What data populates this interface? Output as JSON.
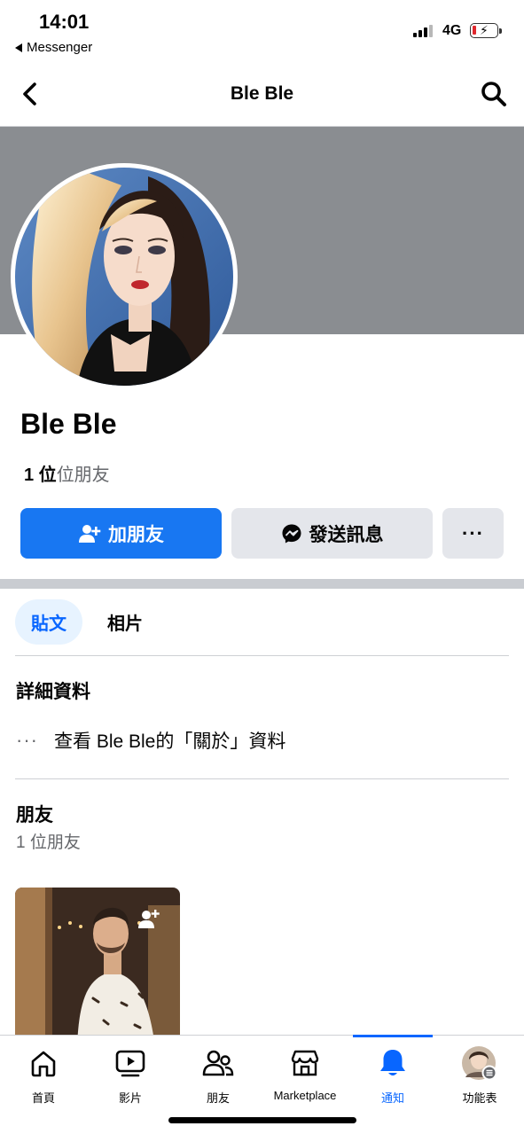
{
  "status_bar": {
    "time": "14:01",
    "back_app": "Messenger",
    "network": "4G"
  },
  "nav": {
    "title": "Ble Ble"
  },
  "profile": {
    "name": "Ble Ble",
    "friend_count_number": "1 位",
    "friend_count_suffix": "位朋友"
  },
  "actions": {
    "add_friend": "加朋友",
    "send_message": "發送訊息",
    "more": "···"
  },
  "tabs": [
    {
      "label": "貼文",
      "active": true
    },
    {
      "label": "相片",
      "active": false
    }
  ],
  "details": {
    "title": "詳細資料",
    "more_dots": "···",
    "about_link": "查看 Ble Ble的「關於」資料"
  },
  "friends": {
    "title": "朋友",
    "subtitle": "1 位朋友"
  },
  "tabbar": {
    "items": [
      {
        "label": "首頁",
        "icon": "home-icon"
      },
      {
        "label": "影片",
        "icon": "video-icon"
      },
      {
        "label": "朋友",
        "icon": "friends-icon"
      },
      {
        "label": "Marketplace",
        "icon": "marketplace-icon"
      },
      {
        "label": "通知",
        "icon": "bell-icon",
        "active": true
      },
      {
        "label": "功能表",
        "icon": "menu-avatar-icon"
      }
    ]
  },
  "colors": {
    "primary": "#1877f2",
    "active_tab": "#0866ff",
    "cover": "#8a8d91",
    "secondary_button": "#e4e6eb"
  }
}
